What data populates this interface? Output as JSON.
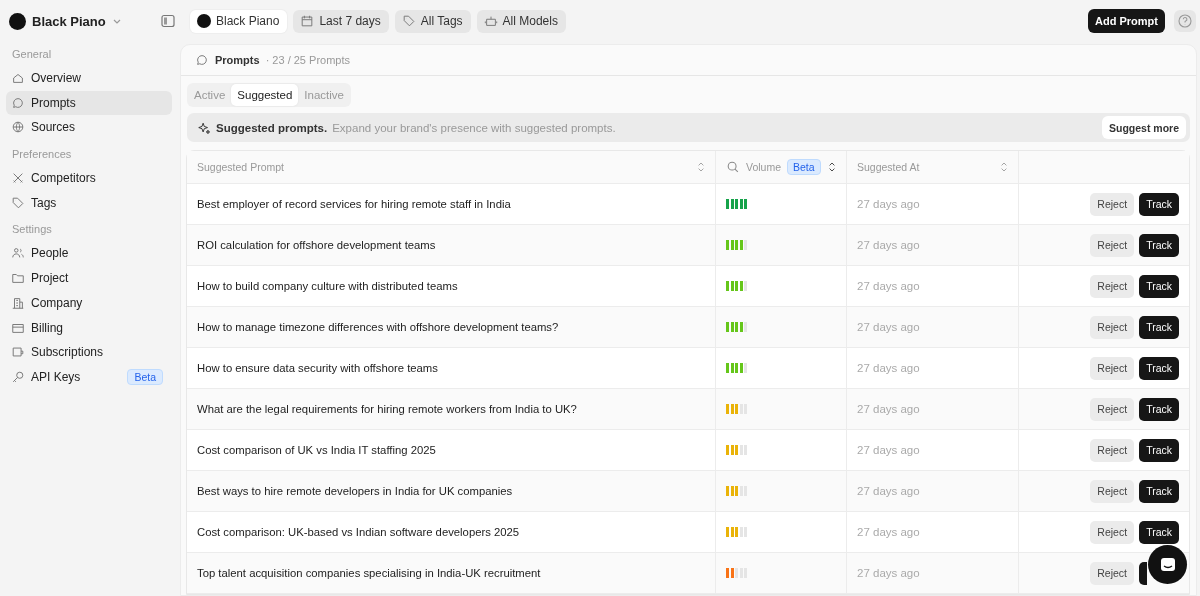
{
  "workspace": {
    "name": "Black Piano"
  },
  "sidebar": {
    "sections": [
      {
        "title": "General",
        "items": [
          {
            "label": "Overview",
            "selected": false
          },
          {
            "label": "Prompts",
            "selected": true
          },
          {
            "label": "Sources",
            "selected": false
          }
        ]
      },
      {
        "title": "Preferences",
        "items": [
          {
            "label": "Competitors",
            "selected": false
          },
          {
            "label": "Tags",
            "selected": false
          }
        ]
      },
      {
        "title": "Settings",
        "items": [
          {
            "label": "People",
            "selected": false
          },
          {
            "label": "Project",
            "selected": false
          },
          {
            "label": "Company",
            "selected": false
          },
          {
            "label": "Billing",
            "selected": false
          },
          {
            "label": "Subscriptions",
            "selected": false
          },
          {
            "label": "API Keys",
            "selected": false,
            "badge": "Beta"
          }
        ]
      }
    ]
  },
  "filters": [
    {
      "label": "Black Piano",
      "selected": true
    },
    {
      "label": "Last 7 days",
      "selected": false
    },
    {
      "label": "All Tags",
      "selected": false
    },
    {
      "label": "All Models",
      "selected": false
    }
  ],
  "add_button": "Add Prompt",
  "page": {
    "title": "Prompts",
    "count": "· 23 / 25 Prompts"
  },
  "tabs": [
    {
      "label": "Active",
      "selected": false
    },
    {
      "label": "Suggested",
      "selected": true
    },
    {
      "label": "Inactive",
      "selected": false
    }
  ],
  "banner": {
    "title": "Suggested prompts.",
    "text": "Expand your brand's presence with suggested prompts.",
    "button": "Suggest more"
  },
  "table": {
    "columns": [
      {
        "label": "Suggested Prompt"
      },
      {
        "label": "Volume",
        "badge": "Beta"
      },
      {
        "label": "Suggested At"
      }
    ],
    "rows": [
      {
        "prompt": "Best employer of record services for hiring remote staff in India",
        "level": 1,
        "suggested_at": "27 days ago",
        "reject": "Reject",
        "track": "Track"
      },
      {
        "prompt": "ROI calculation for offshore development teams",
        "level": 0.8,
        "suggested_at": "27 days ago",
        "reject": "Reject",
        "track": "Track"
      },
      {
        "prompt": "How to build company culture with distributed teams",
        "level": 0.8,
        "suggested_at": "27 days ago",
        "reject": "Reject",
        "track": "Track"
      },
      {
        "prompt": "How to manage timezone differences with offshore development teams?",
        "level": 0.8,
        "suggested_at": "27 days ago",
        "reject": "Reject",
        "track": "Track"
      },
      {
        "prompt": "How to ensure data security with offshore teams",
        "level": 0.8,
        "suggested_at": "27 days ago",
        "reject": "Reject",
        "track": "Track"
      },
      {
        "prompt": "What are the legal requirements for hiring remote workers from India to UK?",
        "level": 0.6,
        "suggested_at": "27 days ago",
        "reject": "Reject",
        "track": "Track"
      },
      {
        "prompt": "Cost comparison of UK vs India IT staffing 2025",
        "level": 0.6,
        "suggested_at": "27 days ago",
        "reject": "Reject",
        "track": "Track"
      },
      {
        "prompt": "Best ways to hire remote developers in India for UK companies",
        "level": 0.6,
        "suggested_at": "27 days ago",
        "reject": "Reject",
        "track": "Track"
      },
      {
        "prompt": "Cost comparison: UK-based vs Indian software developers 2025",
        "level": 0.6,
        "suggested_at": "27 days ago",
        "reject": "Reject",
        "track": "Track"
      },
      {
        "prompt": "Top talent acquisition companies specialising in India-UK recruitment",
        "level": 0.4,
        "suggested_at": "27 days ago",
        "reject": "Reject"
      }
    ]
  }
}
